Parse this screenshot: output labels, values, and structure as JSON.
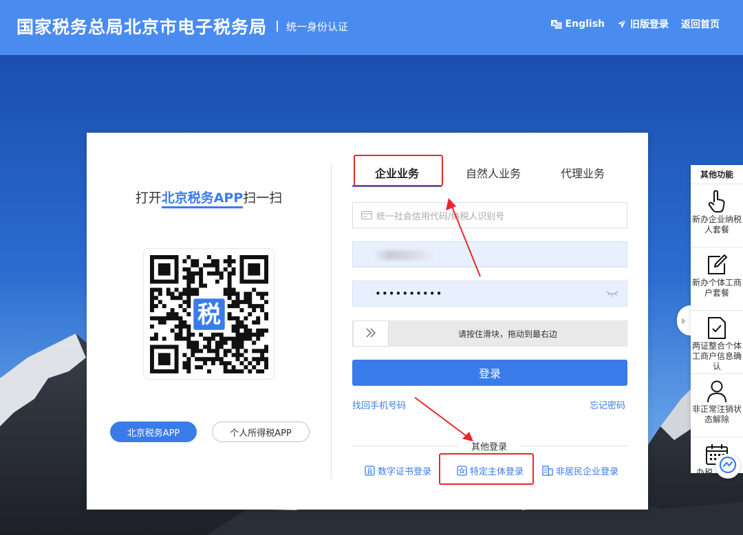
{
  "header": {
    "title": "国家税务总局北京市电子税务局",
    "subtitle": "统一身份认证",
    "links": [
      {
        "label": "English",
        "icon": "language-icon"
      },
      {
        "label": "旧版登录",
        "icon": "paper-plane-icon"
      },
      {
        "label": "返回首页",
        "icon": ""
      }
    ]
  },
  "scan": {
    "prefix": "打开",
    "app_name": "北京税务APP",
    "suffix": "扫一扫",
    "qr_center_char": "税"
  },
  "app_buttons": {
    "primary": "北京税务APP",
    "secondary": "个人所得税APP"
  },
  "tabs": [
    {
      "label": "企业业务",
      "active": true
    },
    {
      "label": "自然人业务",
      "active": false
    },
    {
      "label": "代理业务",
      "active": false
    }
  ],
  "form": {
    "credit_code_placeholder": "统一社会信用代码/纳税人识别号",
    "password_masked": "••••••••••",
    "slider_text": "请按住滑块，拖动到最右边",
    "login_label": "登录",
    "find_phone_link": "找回手机号码",
    "forgot_password_link": "忘记密码"
  },
  "other_login": {
    "label": "其他登录",
    "options": [
      {
        "label": "数字证书登录",
        "icon": "certificate-icon"
      },
      {
        "label": "特定主体登录",
        "icon": "star-badge-icon"
      },
      {
        "label": "非居民企业登录",
        "icon": "building-icon"
      }
    ]
  },
  "side_panel": {
    "title": "其他功能",
    "items": [
      {
        "label": "新办企业纳税人套餐",
        "icon": "hand-pointer-icon"
      },
      {
        "label": "新办个体工商户套餐",
        "icon": "edit-icon"
      },
      {
        "label": "两证整合个体工商户信息确认",
        "icon": "document-check-icon"
      },
      {
        "label": "非正常注销状态解除",
        "icon": "person-icon"
      },
      {
        "label": "办税",
        "icon": "calendar-icon"
      }
    ]
  },
  "colors": {
    "header_bg": "#4a8bf0",
    "accent": "#3a7bea",
    "annotation": "#e8262b"
  }
}
